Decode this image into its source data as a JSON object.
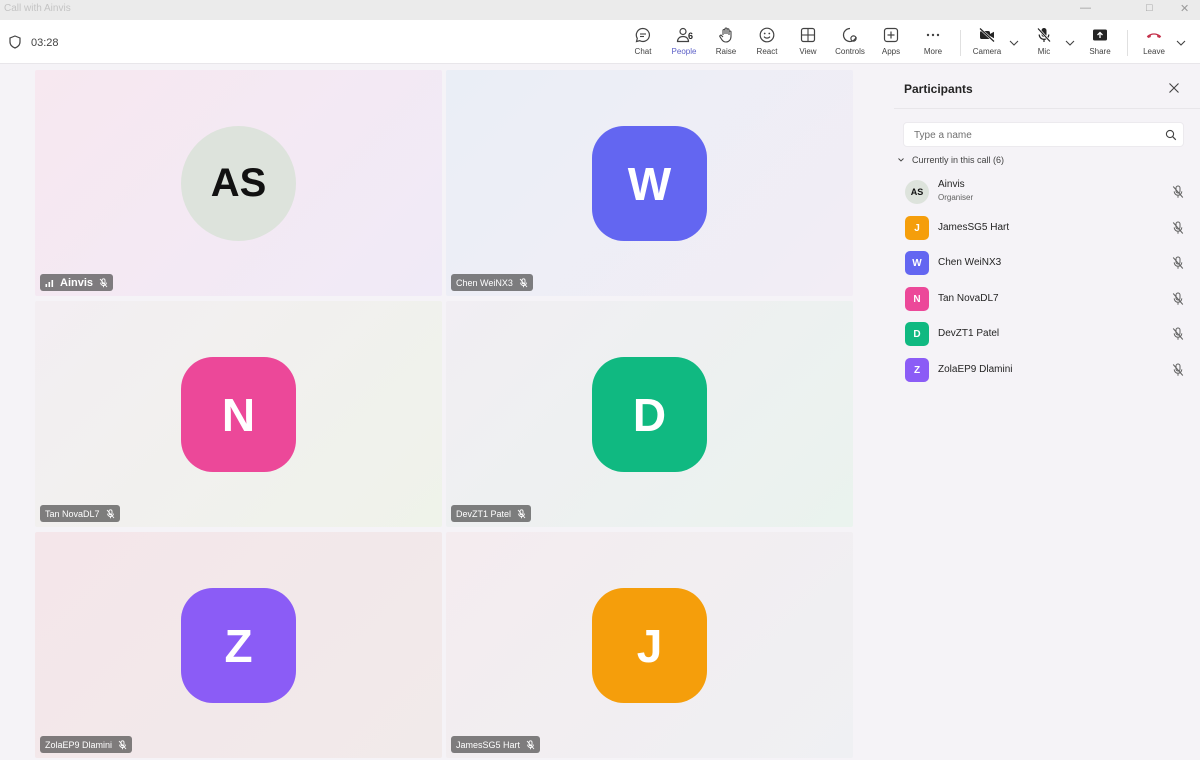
{
  "window": {
    "title": "Call with Ainvis"
  },
  "call": {
    "timer": "03:28"
  },
  "toolbar": {
    "chat": "Chat",
    "people": "People",
    "people_count": "6",
    "raise": "Raise",
    "react": "React",
    "view": "View",
    "controls": "Controls",
    "apps": "Apps",
    "more": "More",
    "camera": "Camera",
    "mic": "Mic",
    "share": "Share",
    "leave": "Leave"
  },
  "tiles": [
    {
      "name": "Ainvis",
      "initials": "AS",
      "color": "#dde3dc"
    },
    {
      "name": "Chen WeiNX3",
      "initials": "W",
      "color": "#6366f1"
    },
    {
      "name": "Tan NovaDL7",
      "initials": "N",
      "color": "#ec4899"
    },
    {
      "name": "DevZT1 Patel",
      "initials": "D",
      "color": "#10b981"
    },
    {
      "name": "ZolaEP9 Dlamini",
      "initials": "Z",
      "color": "#8b5cf6"
    },
    {
      "name": "JamesSG5 Hart",
      "initials": "J",
      "color": "#f59e0b"
    }
  ],
  "panel": {
    "title": "Participants",
    "search_placeholder": "Type a name",
    "section_label": "Currently in this call (6)",
    "participants": [
      {
        "initials": "AS",
        "name": "Ainvis",
        "role": "Organiser",
        "color": "#dde3dc"
      },
      {
        "initials": "J",
        "name": "JamesSG5 Hart",
        "color": "#f59e0b"
      },
      {
        "initials": "W",
        "name": "Chen WeiNX3",
        "color": "#6366f1"
      },
      {
        "initials": "N",
        "name": "Tan NovaDL7",
        "color": "#ec4899"
      },
      {
        "initials": "D",
        "name": "DevZT1 Patel",
        "color": "#10b981"
      },
      {
        "initials": "Z",
        "name": "ZolaEP9 Dlamini",
        "color": "#8b5cf6"
      }
    ]
  },
  "colors": {
    "accent": "#5b5fc7",
    "leave": "#c4314b"
  }
}
